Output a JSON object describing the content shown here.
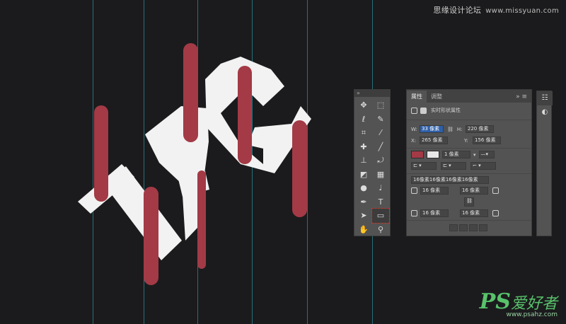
{
  "watermark": {
    "top_cn": "思缘设计论坛",
    "top_url": "www.missyuan.com",
    "bottom_ps": "PS",
    "bottom_cn": "爱好者",
    "bottom_url": "www.psahz.com"
  },
  "artwork_text": "TAG",
  "colors": {
    "canvas": "#1b1b1d",
    "letters": "#f2f2f2",
    "bars": "#a33a46",
    "guides": "#2a8e9a"
  },
  "toolbar": {
    "header": "»",
    "tools": [
      {
        "name": "move-tool-icon",
        "glyph": "✥"
      },
      {
        "name": "marquee-tool-icon",
        "glyph": "⬚"
      },
      {
        "name": "lasso-tool-icon",
        "glyph": "ℓ"
      },
      {
        "name": "quick-select-tool-icon",
        "glyph": "✎"
      },
      {
        "name": "crop-tool-icon",
        "glyph": "⌗"
      },
      {
        "name": "eyedropper-tool-icon",
        "glyph": "⁄"
      },
      {
        "name": "healing-tool-icon",
        "glyph": "✚"
      },
      {
        "name": "brush-tool-icon",
        "glyph": "╱"
      },
      {
        "name": "stamp-tool-icon",
        "glyph": "⊥"
      },
      {
        "name": "history-brush-tool-icon",
        "glyph": "⤾"
      },
      {
        "name": "eraser-tool-icon",
        "glyph": "◩"
      },
      {
        "name": "gradient-tool-icon",
        "glyph": "▦"
      },
      {
        "name": "blur-tool-icon",
        "glyph": "●"
      },
      {
        "name": "dodge-tool-icon",
        "glyph": "♩"
      },
      {
        "name": "pen-tool-icon",
        "glyph": "✒"
      },
      {
        "name": "type-tool-icon",
        "glyph": "T"
      },
      {
        "name": "path-select-tool-icon",
        "glyph": "➤"
      },
      {
        "name": "rectangle-tool-icon",
        "glyph": "▭"
      },
      {
        "name": "hand-tool-icon",
        "glyph": "✋"
      },
      {
        "name": "zoom-tool-icon",
        "glyph": "⚲"
      }
    ]
  },
  "properties": {
    "tabs": [
      "属性",
      "调整"
    ],
    "more": "»  ≡",
    "header_label": "实时形状属性",
    "w_label": "W:",
    "w_value": "33 像素",
    "h_label": "H:",
    "h_value": "220 像素",
    "x_label": "X:",
    "x_value": "265 像素",
    "y_label": "Y:",
    "y_value": "156 像素",
    "stroke_width": "1 像素",
    "corner_all": "16像素16像素16像素16像素",
    "tl": "16 像素",
    "tr": "16 像素",
    "bl": "16 像素",
    "br": "16 像素"
  }
}
